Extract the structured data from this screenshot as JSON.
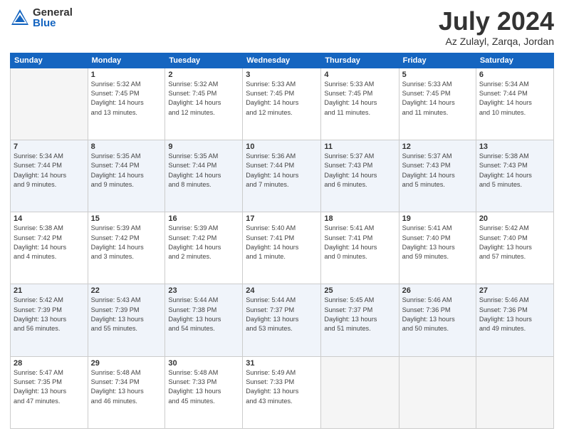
{
  "logo": {
    "general": "General",
    "blue": "Blue"
  },
  "title": "July 2024",
  "subtitle": "Az Zulayl, Zarqa, Jordan",
  "days_of_week": [
    "Sunday",
    "Monday",
    "Tuesday",
    "Wednesday",
    "Thursday",
    "Friday",
    "Saturday"
  ],
  "weeks": [
    [
      {
        "day": "",
        "text": ""
      },
      {
        "day": "1",
        "text": "Sunrise: 5:32 AM\nSunset: 7:45 PM\nDaylight: 14 hours\nand 13 minutes."
      },
      {
        "day": "2",
        "text": "Sunrise: 5:32 AM\nSunset: 7:45 PM\nDaylight: 14 hours\nand 12 minutes."
      },
      {
        "day": "3",
        "text": "Sunrise: 5:33 AM\nSunset: 7:45 PM\nDaylight: 14 hours\nand 12 minutes."
      },
      {
        "day": "4",
        "text": "Sunrise: 5:33 AM\nSunset: 7:45 PM\nDaylight: 14 hours\nand 11 minutes."
      },
      {
        "day": "5",
        "text": "Sunrise: 5:33 AM\nSunset: 7:45 PM\nDaylight: 14 hours\nand 11 minutes."
      },
      {
        "day": "6",
        "text": "Sunrise: 5:34 AM\nSunset: 7:44 PM\nDaylight: 14 hours\nand 10 minutes."
      }
    ],
    [
      {
        "day": "7",
        "text": "Sunrise: 5:34 AM\nSunset: 7:44 PM\nDaylight: 14 hours\nand 9 minutes."
      },
      {
        "day": "8",
        "text": "Sunrise: 5:35 AM\nSunset: 7:44 PM\nDaylight: 14 hours\nand 9 minutes."
      },
      {
        "day": "9",
        "text": "Sunrise: 5:35 AM\nSunset: 7:44 PM\nDaylight: 14 hours\nand 8 minutes."
      },
      {
        "day": "10",
        "text": "Sunrise: 5:36 AM\nSunset: 7:44 PM\nDaylight: 14 hours\nand 7 minutes."
      },
      {
        "day": "11",
        "text": "Sunrise: 5:37 AM\nSunset: 7:43 PM\nDaylight: 14 hours\nand 6 minutes."
      },
      {
        "day": "12",
        "text": "Sunrise: 5:37 AM\nSunset: 7:43 PM\nDaylight: 14 hours\nand 5 minutes."
      },
      {
        "day": "13",
        "text": "Sunrise: 5:38 AM\nSunset: 7:43 PM\nDaylight: 14 hours\nand 5 minutes."
      }
    ],
    [
      {
        "day": "14",
        "text": "Sunrise: 5:38 AM\nSunset: 7:42 PM\nDaylight: 14 hours\nand 4 minutes."
      },
      {
        "day": "15",
        "text": "Sunrise: 5:39 AM\nSunset: 7:42 PM\nDaylight: 14 hours\nand 3 minutes."
      },
      {
        "day": "16",
        "text": "Sunrise: 5:39 AM\nSunset: 7:42 PM\nDaylight: 14 hours\nand 2 minutes."
      },
      {
        "day": "17",
        "text": "Sunrise: 5:40 AM\nSunset: 7:41 PM\nDaylight: 14 hours\nand 1 minute."
      },
      {
        "day": "18",
        "text": "Sunrise: 5:41 AM\nSunset: 7:41 PM\nDaylight: 14 hours\nand 0 minutes."
      },
      {
        "day": "19",
        "text": "Sunrise: 5:41 AM\nSunset: 7:40 PM\nDaylight: 13 hours\nand 59 minutes."
      },
      {
        "day": "20",
        "text": "Sunrise: 5:42 AM\nSunset: 7:40 PM\nDaylight: 13 hours\nand 57 minutes."
      }
    ],
    [
      {
        "day": "21",
        "text": "Sunrise: 5:42 AM\nSunset: 7:39 PM\nDaylight: 13 hours\nand 56 minutes."
      },
      {
        "day": "22",
        "text": "Sunrise: 5:43 AM\nSunset: 7:39 PM\nDaylight: 13 hours\nand 55 minutes."
      },
      {
        "day": "23",
        "text": "Sunrise: 5:44 AM\nSunset: 7:38 PM\nDaylight: 13 hours\nand 54 minutes."
      },
      {
        "day": "24",
        "text": "Sunrise: 5:44 AM\nSunset: 7:37 PM\nDaylight: 13 hours\nand 53 minutes."
      },
      {
        "day": "25",
        "text": "Sunrise: 5:45 AM\nSunset: 7:37 PM\nDaylight: 13 hours\nand 51 minutes."
      },
      {
        "day": "26",
        "text": "Sunrise: 5:46 AM\nSunset: 7:36 PM\nDaylight: 13 hours\nand 50 minutes."
      },
      {
        "day": "27",
        "text": "Sunrise: 5:46 AM\nSunset: 7:36 PM\nDaylight: 13 hours\nand 49 minutes."
      }
    ],
    [
      {
        "day": "28",
        "text": "Sunrise: 5:47 AM\nSunset: 7:35 PM\nDaylight: 13 hours\nand 47 minutes."
      },
      {
        "day": "29",
        "text": "Sunrise: 5:48 AM\nSunset: 7:34 PM\nDaylight: 13 hours\nand 46 minutes."
      },
      {
        "day": "30",
        "text": "Sunrise: 5:48 AM\nSunset: 7:33 PM\nDaylight: 13 hours\nand 45 minutes."
      },
      {
        "day": "31",
        "text": "Sunrise: 5:49 AM\nSunset: 7:33 PM\nDaylight: 13 hours\nand 43 minutes."
      },
      {
        "day": "",
        "text": ""
      },
      {
        "day": "",
        "text": ""
      },
      {
        "day": "",
        "text": ""
      }
    ]
  ]
}
